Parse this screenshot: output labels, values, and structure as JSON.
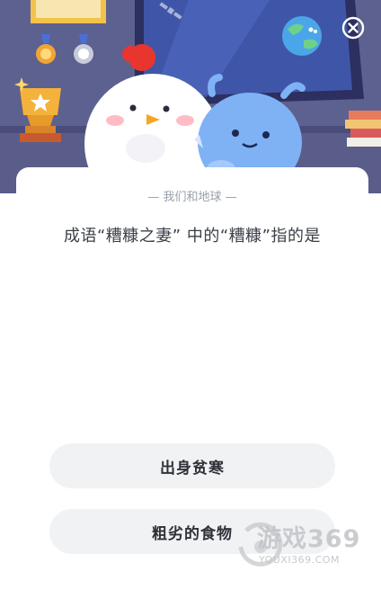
{
  "quiz": {
    "category": "— 我们和地球 —",
    "question": "成语“糟糠之妻” 中的“糟糠”指的是",
    "options": [
      {
        "label": "出身贫寒"
      },
      {
        "label": "粗劣的食物"
      }
    ]
  },
  "watermark": {
    "title": "游戏369",
    "url": "YOUXI369.COM"
  },
  "icons": {
    "close": "close-icon",
    "earth": "earth-icon",
    "trophy": "trophy-icon",
    "medal": "medal-icon",
    "chicken": "chicken-mascot",
    "alien": "alien-mascot",
    "books": "books-icon"
  },
  "colors": {
    "hero_bg": "#5b5f8e",
    "option_bg": "#f1f2f4",
    "question_text": "#3b3f48",
    "category_text": "#9aa0aa"
  }
}
